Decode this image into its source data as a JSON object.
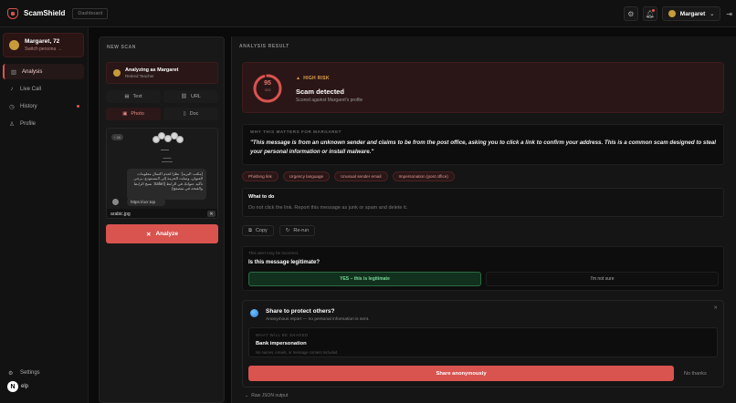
{
  "app": {
    "name": "ScamShield",
    "tag": "Dashboard"
  },
  "topbar": {
    "user": "Margaret",
    "exit_icon": "logout-icon"
  },
  "sidebar": {
    "persona_name": "Margaret, 72",
    "persona_action": "Switch persona →",
    "items": [
      {
        "label": "Analysis",
        "icon": "chart-icon"
      },
      {
        "label": "Live Call",
        "icon": "mic-icon"
      },
      {
        "label": "History",
        "icon": "clock-icon"
      },
      {
        "label": "Profile",
        "icon": "user-icon"
      }
    ],
    "settings_label": "Settings",
    "user_initial": "N",
    "user_label": "elp"
  },
  "new_scan": {
    "title": "NEW SCAN",
    "analyzing_as": "Analyzing as Margaret",
    "persona_role": "Retired Teacher",
    "tabs": {
      "text": "Text",
      "url": "URL",
      "photo": "Photo",
      "doc": "Doc"
    },
    "preview": {
      "back": "‹ 26",
      "arabic": "(مكتب البريد): نظرًا لعدم اكتمال معلومات العنوان، وصلت الحزمة إلى المستودع، يرجى تأكيد عنوانك في الرابط (Safari: نسخ الرابط والفتحه في متصفح)",
      "link": "https://ucr.top",
      "filename": "arabic.jpg",
      "remove": "✕"
    },
    "analyze_label": "Analyze"
  },
  "result": {
    "title": "ANALYSIS RESULT",
    "score": "95",
    "score_max": "/100",
    "score_fraction": 0.95,
    "risk": "HIGH RISK",
    "verdict": "Scam detected",
    "scored_against": "Scored against Margaret's profile",
    "why_title": "WHY THIS MATTERS FOR MARGARET",
    "why_text": "\"This message is from an unknown sender and claims to be from the post office, asking you to click a link to confirm your address. This is a common scam designed to steal your personal information or install malware.\"",
    "chips": [
      "Phishing link",
      "Urgency language",
      "Unusual sender email",
      "Impersonation (post office)"
    ],
    "todo_title": "What to do",
    "todo_text": "Do not click the link. Report this message as junk or spam and delete it.",
    "copy_label": "Copy",
    "rerun_label": "Re-run"
  },
  "feedback": {
    "note": "This alert may be incorrect.",
    "question": "Is this message legitimate?",
    "yes": "YES – this is legitimate",
    "no": "I'm not sure"
  },
  "share": {
    "title": "Share to protect others?",
    "subtitle": "Anonymous report — no personal information is sent.",
    "box_label": "WHAT WILL BE SHARED",
    "box_value": "Bank impersonation",
    "box_note": "No names, emails, or message content included",
    "button": "Share anonymously",
    "decline": "No thanks"
  },
  "raw_json_label": "Raw JSON output",
  "colors": {
    "accent": "#d9534f",
    "risk": "#e0a34f",
    "success": "#7ad79a"
  }
}
